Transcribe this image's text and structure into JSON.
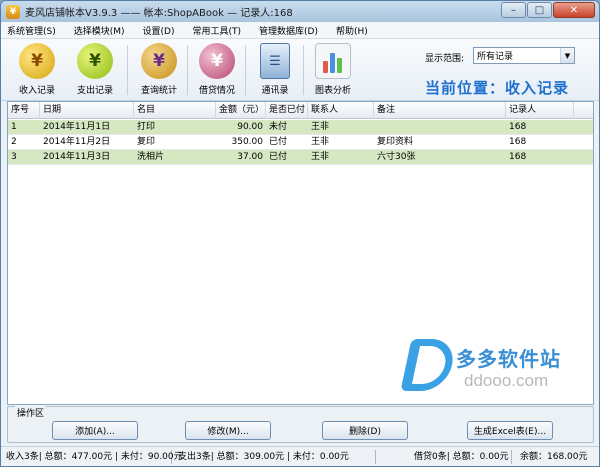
{
  "window": {
    "title": "麦风店铺帐本V3.9.3 —— 帐本:ShopABook — 记录人:168",
    "app_icon_glyph": "¥",
    "controls": [
      "–",
      "□",
      "✕"
    ]
  },
  "menu": [
    "系统管理(S)",
    "选择模块(M)",
    "设置(D)",
    "常用工具(T)",
    "管理数据库(D)",
    "帮助(H)"
  ],
  "toolbar": {
    "buttons": [
      {
        "label": "收入记录",
        "icon": "income-yen-icon",
        "glyph": "¥"
      },
      {
        "label": "支出记录",
        "icon": "expense-yen-icon",
        "glyph": "¥"
      },
      {
        "label": "查询统计",
        "icon": "query-stats-icon",
        "glyph": "¥"
      },
      {
        "label": "借贷情况",
        "icon": "loan-icon",
        "glyph": "¥"
      },
      {
        "label": "通讯录",
        "icon": "contacts-book-icon",
        "glyph": "☰"
      },
      {
        "label": "图表分析",
        "icon": "chart-analysis-icon",
        "glyph": ""
      }
    ],
    "scope_label": "显示范围:",
    "scope_value": "所有记录",
    "location": "当前位置：收入记录"
  },
  "table": {
    "columns": [
      "序号",
      "日期",
      "名目",
      "金额（元）",
      "是否已付",
      "联系人",
      "备注",
      "记录人"
    ],
    "rows": [
      [
        "1",
        "2014年11月1日",
        "打印",
        "90.00",
        "未付",
        "王非",
        "",
        "168"
      ],
      [
        "2",
        "2014年11月2日",
        "复印",
        "350.00",
        "已付",
        "王非",
        "复印资料",
        "168"
      ],
      [
        "3",
        "2014年11月3日",
        "洗相片",
        "37.00",
        "已付",
        "王非",
        "六寸30张",
        "168"
      ]
    ]
  },
  "watermark": {
    "line1": "多多软件站",
    "line2": "ddooo.com"
  },
  "operations": {
    "title": "操作区",
    "add": "添加(A)...",
    "edit": "修改(M)...",
    "delete": "删除(D)",
    "excel": "生成Excel表(E)..."
  },
  "status": [
    "收入3条| 总额：477.00元 | 未付：90.00元",
    "支出3条| 总额：309.00元 | 未付：0.00元",
    "借贷0条| 总额：0.00元",
    "余额：168.00元"
  ],
  "colors": {
    "row_highlight": "#d5e8c2",
    "location_text": "#1e6fd0",
    "watermark_blue": "#3aa2e4"
  }
}
